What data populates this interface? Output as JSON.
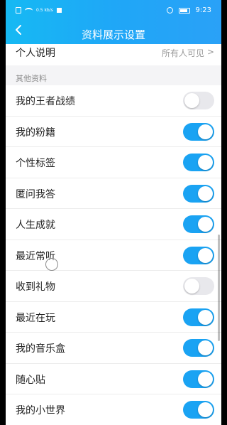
{
  "status_bar": {
    "speed": "0.5 kb/s",
    "time": "9:23"
  },
  "header": {
    "title": "资料展示设置"
  },
  "personal": {
    "label": "个人说明",
    "value": "所有人可见",
    "chevron": ">"
  },
  "section": {
    "title": "其他资料"
  },
  "items": [
    {
      "label": "我的王者战绩",
      "on": false
    },
    {
      "label": "我的粉籍",
      "on": true
    },
    {
      "label": "个性标签",
      "on": true
    },
    {
      "label": "匿问我答",
      "on": true
    },
    {
      "label": "人生成就",
      "on": true
    },
    {
      "label": "最近常听",
      "on": true
    },
    {
      "label": "收到礼物",
      "on": false
    },
    {
      "label": "最近在玩",
      "on": true
    },
    {
      "label": "我的音乐盒",
      "on": true
    },
    {
      "label": "随心贴",
      "on": true
    },
    {
      "label": "我的小世界",
      "on": true
    }
  ],
  "colors": {
    "header_bg": "#1fa7f7",
    "switch_on": "#1aa3f3",
    "switch_off": "#e8e8ec"
  }
}
